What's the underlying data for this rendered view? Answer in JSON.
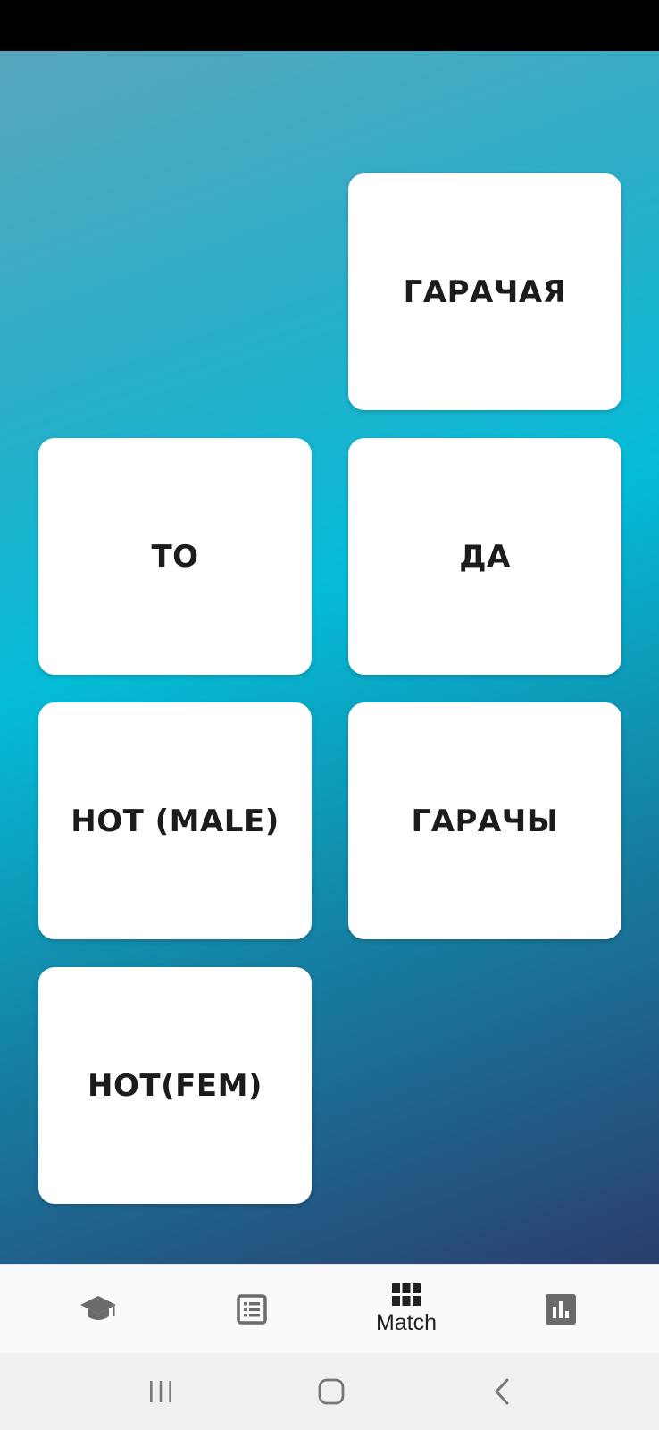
{
  "cards": [
    {
      "label": "ГАРАЧАЯ"
    },
    {
      "label": "ТО"
    },
    {
      "label": "ДА"
    },
    {
      "label": "HOT (MALE)"
    },
    {
      "label": "ГАРАЧЫ"
    },
    {
      "label": "HOT(FEM)"
    }
  ],
  "bottom_nav": {
    "items": [
      {
        "icon": "graduation-cap-icon",
        "label": ""
      },
      {
        "icon": "list-icon",
        "label": ""
      },
      {
        "icon": "grid-icon",
        "label": "Match"
      },
      {
        "icon": "bar-chart-icon",
        "label": ""
      }
    ],
    "active_index": 2
  },
  "system_nav": {
    "buttons": [
      "recent-apps-icon",
      "home-icon",
      "back-icon"
    ]
  },
  "colors": {
    "gradient_top": "#58a6bd",
    "gradient_mid": "#05bcd8",
    "gradient_bottom": "#2b3d6f",
    "card_bg": "#ffffff",
    "card_text": "#1c1c1c",
    "icon_gray": "#6b6b6b"
  }
}
